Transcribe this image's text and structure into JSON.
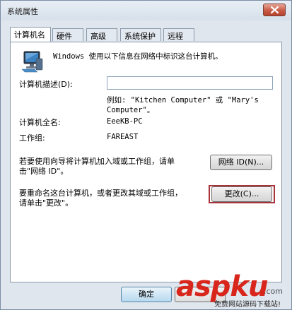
{
  "window": {
    "title": "系统属性"
  },
  "tabs": [
    {
      "label": "计算机名",
      "active": true
    },
    {
      "label": "硬件",
      "active": false
    },
    {
      "label": "高级",
      "active": false
    },
    {
      "label": "系统保护",
      "active": false
    },
    {
      "label": "远程",
      "active": false
    }
  ],
  "panel": {
    "intro": "Windows 使用以下信息在网络中标识这台计算机。",
    "description_label": "计算机描述(D):",
    "description_value": "",
    "example_line1": "例如: \"Kitchen Computer\" 或 \"Mary's",
    "example_line2": "Computer\"。",
    "fullname_label": "计算机全名:",
    "fullname_value": "EeeKB-PC",
    "workgroup_label": "工作组:",
    "workgroup_value": "FAREAST",
    "network_text_line1": "若要使用向导将计算机加入域或工作组，请单",
    "network_text_line2": "击\"网络 ID\"。",
    "network_id_button": "网络 ID(N)...",
    "rename_text_line1": "要重命名这台计算机，或者更改其域或工作组，",
    "rename_text_line2": "请单击\"更改\"。",
    "change_button": "更改(C)..."
  },
  "footer": {
    "ok_button": "确定"
  },
  "watermark": {
    "brand": "aspku",
    "domain_suffix": ".com",
    "tagline": "免费网站源码下载站!"
  },
  "colors": {
    "highlight": "#a8343a",
    "watermark_red": "#d8261c"
  }
}
